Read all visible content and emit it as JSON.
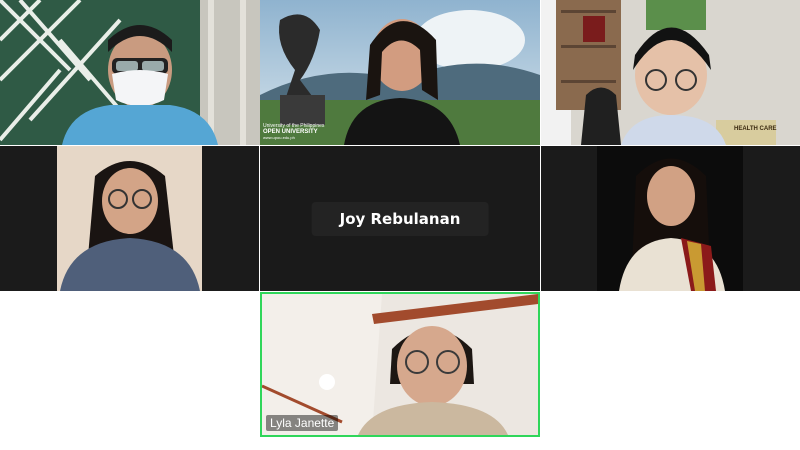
{
  "participants": [
    {
      "name": "",
      "note": "masked participant"
    },
    {
      "name": "",
      "backdrop_text": [
        "University of the Philippines",
        "OPEN UNIVERSITY",
        "www.upou.edu.ph"
      ]
    },
    {
      "name": "",
      "label": "HEALTH CARE"
    },
    {
      "name": ""
    },
    {
      "name": "Joy Rebulanan"
    },
    {
      "name": ""
    },
    {
      "name": "Lyla Janette"
    }
  ],
  "colors": {
    "active_speaker_border": "#2fd65a",
    "tile_background": "#1a1a1a"
  }
}
